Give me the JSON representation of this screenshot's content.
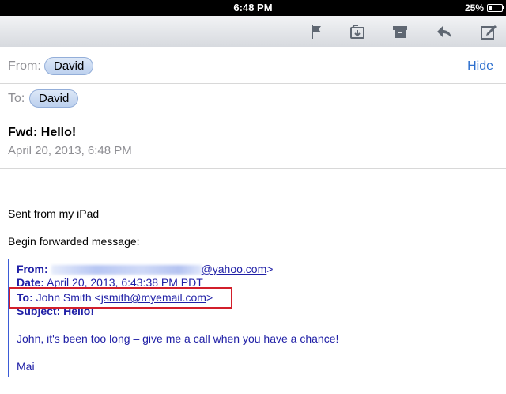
{
  "status_bar": {
    "time": "6:48 PM",
    "battery": "25%",
    "battery_level": 0.25
  },
  "toolbar": {
    "icons": [
      "flag-icon",
      "move-folder-icon",
      "archive-icon",
      "reply-icon",
      "compose-icon"
    ]
  },
  "header": {
    "from_label": "From:",
    "from_name": "David",
    "hide_label": "Hide",
    "to_label": "To:",
    "to_name": "David",
    "subject": "Fwd: Hello!",
    "date": "April 20, 2013, 6:48 PM"
  },
  "body": {
    "sent_from": "Sent from my iPad",
    "begin_forwarded": "Begin forwarded message:",
    "forwarded": {
      "from_label": "From:",
      "from_email_visible": "@yahoo.com",
      "from_close": ">",
      "date_label": "Date:",
      "date_value": "April 20, 2013, 6:43:38 PM PDT",
      "to_label": "To:",
      "to_name": "John Smith <",
      "to_email": "jsmith@myemail.com",
      "to_close": ">",
      "subject_label": "Subject:",
      "subject_value": "Hello!",
      "message": "John, it's been too long – give me a call when you have a chance!",
      "signature": "Mai"
    }
  },
  "colors": {
    "link_blue": "#2c6fce",
    "quote_text": "#1f1fa6",
    "quote_bar": "#3b5bd6",
    "highlight_red": "#d21f2b"
  }
}
